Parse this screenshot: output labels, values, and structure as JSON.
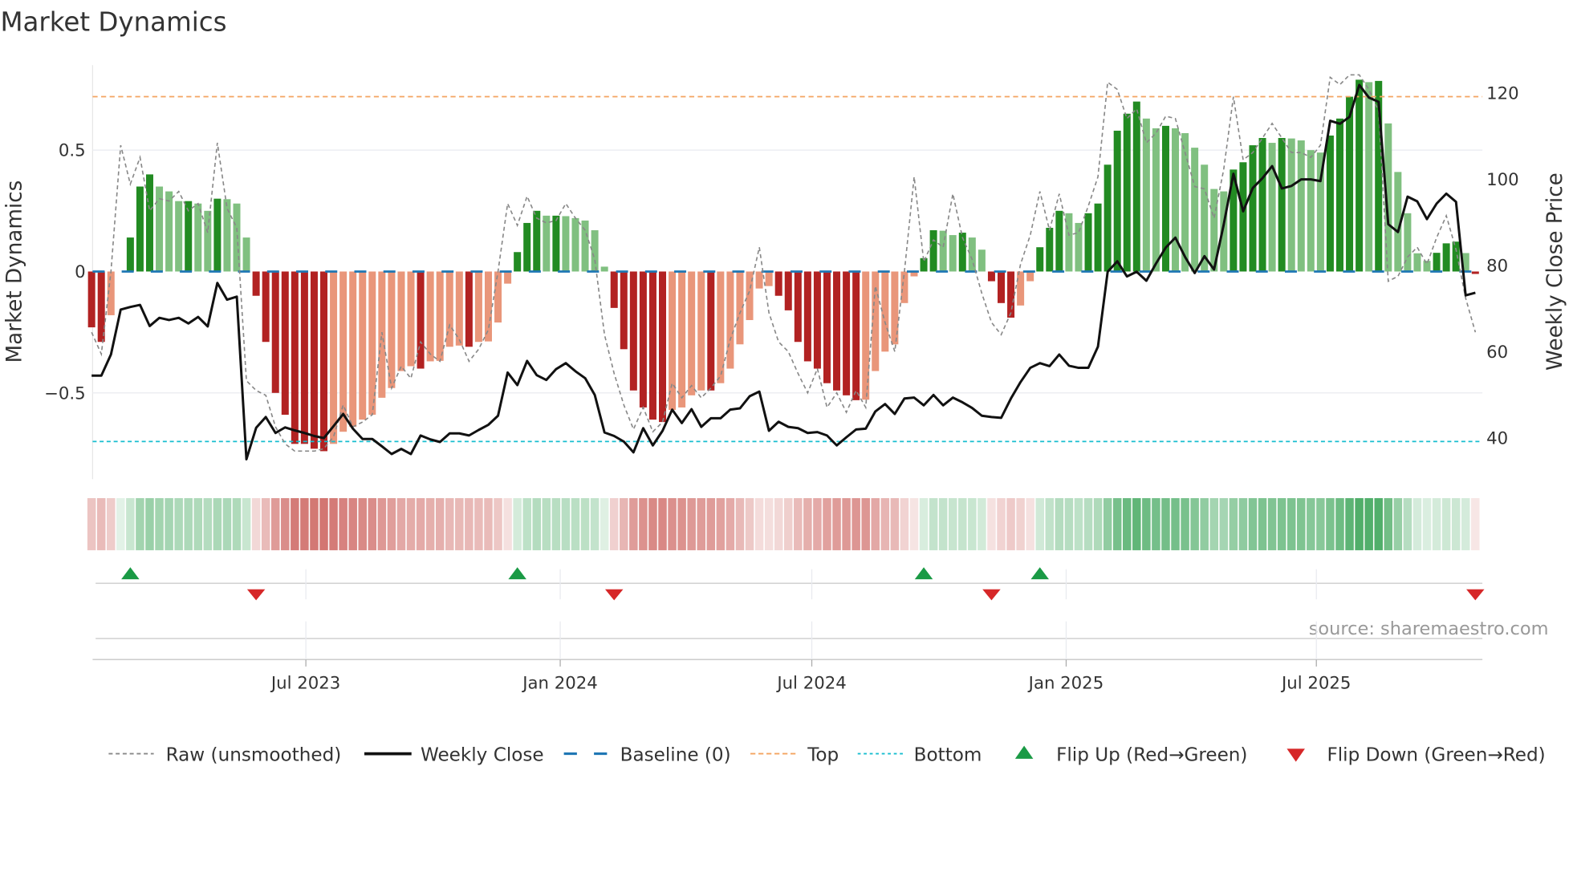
{
  "chart_data": {
    "type": "bar",
    "title": "Market Dynamics",
    "ylabel": "Market Dynamics",
    "y2label": "Weekly Close Price",
    "start_week": "2023-01-27",
    "frequency": "weekly",
    "ylim": [
      -0.855,
      0.85
    ],
    "y2lim": [
      30.5,
      126.5
    ],
    "yticks": [
      {
        "value": 0.5,
        "label": "0.5"
      },
      {
        "value": 0,
        "label": "0"
      },
      {
        "value": -0.5,
        "label": "−0.5"
      }
    ],
    "y2ticks": [
      {
        "value": 120,
        "label": "120"
      },
      {
        "value": 100,
        "label": "100"
      },
      {
        "value": 80,
        "label": "80"
      },
      {
        "value": 60,
        "label": "60"
      },
      {
        "value": 40,
        "label": "40"
      }
    ],
    "xticks": [
      {
        "date": "2023-07-01",
        "label": "Jul 2023"
      },
      {
        "date": "2024-01-01",
        "label": "Jan 2024"
      },
      {
        "date": "2024-07-01",
        "label": "Jul 2024"
      },
      {
        "date": "2025-01-01",
        "label": "Jan 2025"
      },
      {
        "date": "2025-07-01",
        "label": "Jul 2025"
      }
    ],
    "reference_lines": {
      "baseline": 0,
      "top": 0.72,
      "bottom": -0.7
    },
    "values": [
      -0.23,
      -0.29,
      -0.18,
      0,
      0.14,
      0.35,
      0.4,
      0.35,
      0.33,
      0.29,
      0.29,
      0.28,
      0.25,
      0.3,
      0.298,
      0.28,
      0.14,
      -0.1,
      -0.29,
      -0.5,
      -0.59,
      -0.71,
      -0.71,
      -0.73,
      -0.74,
      -0.71,
      -0.66,
      -0.64,
      -0.61,
      -0.59,
      -0.52,
      -0.48,
      -0.41,
      -0.39,
      -0.4,
      -0.37,
      -0.368,
      -0.31,
      -0.305,
      -0.31,
      -0.29,
      -0.288,
      -0.21,
      -0.05,
      0.08,
      0.2,
      0.25,
      0.23,
      0.23,
      0.228,
      0.22,
      0.21,
      0.17,
      0.02,
      -0.15,
      -0.32,
      -0.49,
      -0.56,
      -0.61,
      -0.62,
      -0.57,
      -0.56,
      -0.51,
      -0.49,
      -0.49,
      -0.46,
      -0.4,
      -0.3,
      -0.2,
      -0.07,
      -0.06,
      -0.1,
      -0.16,
      -0.29,
      -0.37,
      -0.4,
      -0.46,
      -0.49,
      -0.51,
      -0.53,
      -0.528,
      -0.41,
      -0.33,
      -0.3,
      -0.13,
      -0.02,
      0.055,
      0.17,
      0.168,
      0.15,
      0.16,
      0.14,
      0.09,
      -0.04,
      -0.13,
      -0.19,
      -0.14,
      -0.04,
      0.1,
      0.18,
      0.25,
      0.24,
      0.2,
      0.24,
      0.28,
      0.44,
      0.58,
      0.65,
      0.7,
      0.63,
      0.59,
      0.6,
      0.59,
      0.57,
      0.51,
      0.44,
      0.34,
      0.33,
      0.42,
      0.45,
      0.52,
      0.55,
      0.53,
      0.55,
      0.548,
      0.54,
      0.5,
      0.49,
      0.56,
      0.63,
      0.72,
      0.79,
      0.78,
      0.785,
      0.61,
      0.41,
      0.24,
      0.075,
      0.044,
      0.077,
      0.116,
      0.123,
      0.076,
      -0.01
    ],
    "raw": [
      -0.25,
      -0.34,
      0.0,
      0.52,
      0.36,
      0.47,
      0.25,
      0.3,
      0.29,
      0.33,
      0.25,
      0.28,
      0.16,
      0.53,
      0.26,
      0.18,
      -0.45,
      -0.49,
      -0.51,
      -0.64,
      -0.71,
      -0.74,
      -0.74,
      -0.74,
      -0.73,
      -0.68,
      -0.55,
      -0.64,
      -0.62,
      -0.59,
      -0.25,
      -0.48,
      -0.39,
      -0.44,
      -0.29,
      -0.34,
      -0.37,
      -0.22,
      -0.28,
      -0.37,
      -0.32,
      -0.24,
      0.0,
      0.28,
      0.19,
      0.31,
      0.22,
      0.2,
      0.21,
      0.28,
      0.22,
      0.17,
      0.05,
      -0.26,
      -0.42,
      -0.55,
      -0.65,
      -0.56,
      -0.66,
      -0.62,
      -0.46,
      -0.52,
      -0.47,
      -0.52,
      -0.48,
      -0.43,
      -0.28,
      -0.17,
      -0.08,
      0.1,
      -0.17,
      -0.29,
      -0.33,
      -0.42,
      -0.5,
      -0.4,
      -0.56,
      -0.5,
      -0.58,
      -0.49,
      -0.56,
      -0.06,
      -0.21,
      -0.33,
      0.0,
      0.39,
      0.04,
      0.13,
      0.1,
      0.32,
      0.14,
      0.05,
      -0.09,
      -0.21,
      -0.26,
      -0.17,
      0.03,
      0.15,
      0.33,
      0.17,
      0.32,
      0.15,
      0.16,
      0.27,
      0.39,
      0.78,
      0.75,
      0.63,
      0.67,
      0.53,
      0.57,
      0.64,
      0.63,
      0.49,
      0.35,
      0.34,
      0.22,
      0.42,
      0.72,
      0.46,
      0.49,
      0.55,
      0.61,
      0.55,
      0.49,
      0.49,
      0.47,
      0.52,
      0.8,
      0.77,
      0.81,
      0.81,
      0.75,
      0.66,
      -0.04,
      -0.02,
      0.06,
      0.1,
      0.03,
      0.14,
      0.23,
      0.09,
      -0.11,
      -0.25
    ],
    "weekly_close": [
      54.5,
      54.5,
      59.4,
      69.8,
      70.4,
      70.9,
      66.0,
      67.9,
      67.4,
      67.9,
      66.6,
      68.1,
      65.9,
      76.0,
      72.1,
      72.8,
      35.1,
      42.4,
      44.9,
      41.2,
      42.5,
      41.8,
      41.2,
      40.5,
      40.0,
      42.8,
      45.6,
      42.2,
      39.8,
      39.8,
      38.1,
      36.3,
      37.5,
      36.3,
      40.6,
      39.7,
      39.1,
      41.1,
      41.1,
      40.6,
      41.9,
      43.1,
      45.2,
      55.2,
      52.3,
      57.9,
      54.6,
      53.5,
      56.0,
      57.4,
      55.5,
      53.9,
      50.0,
      41.3,
      40.5,
      39.2,
      36.7,
      42.3,
      38.3,
      41.7,
      46.6,
      43.5,
      46.7,
      42.6,
      44.6,
      44.6,
      46.6,
      46.9,
      49.7,
      50.8,
      41.7,
      43.8,
      42.6,
      42.3,
      41.2,
      41.4,
      40.6,
      38.3,
      40.2,
      42.0,
      42.2,
      46.2,
      47.9,
      45.6,
      49.2,
      49.4,
      47.6,
      50.0,
      47.6,
      49.4,
      48.3,
      47.0,
      45.2,
      44.9,
      44.7,
      49.2,
      53.0,
      56.3,
      57.4,
      56.7,
      59.4,
      56.8,
      56.3,
      56.3,
      61.2,
      78.6,
      81.0,
      77.5,
      78.6,
      76.5,
      80.5,
      84.2,
      86.5,
      82.0,
      78.3,
      82.2,
      79.1,
      89.5,
      101.3,
      92.6,
      98.0,
      100.3,
      103.1,
      97.9,
      98.5,
      100.0,
      100.0,
      99.6,
      113.6,
      112.9,
      114.5,
      121.9,
      119.0,
      118.0,
      89.6,
      87.8,
      96.0,
      94.9,
      90.8,
      94.4,
      96.7,
      94.8,
      73.1,
      73.7
    ],
    "flips_up": [
      "2023-02-24",
      "2023-12-01",
      "2024-09-20",
      "2024-12-13"
    ],
    "flips_down": [
      "2023-05-26",
      "2024-02-09",
      "2024-11-08",
      "2025-10-24"
    ],
    "colors": {
      "strong_up": "#228b22",
      "weak_up": "#80c080",
      "strong_down": "#b22222",
      "weak_down": "#e9967a",
      "raw": "#888888",
      "close": "#111111",
      "baseline": "#1f77b4",
      "top": "#f4a460",
      "bottom": "#17becf",
      "flip_up": "#1a9a45",
      "flip_down": "#d62728"
    },
    "legend": {
      "placement": "bottom",
      "items": [
        "Raw (unsmoothed)",
        "Weekly Close",
        "Baseline (0)",
        "Top",
        "Bottom",
        "Flip Up (Red→Green)",
        "Flip Down (Green→Red)"
      ]
    },
    "source": "source: sharemaestro.com"
  }
}
